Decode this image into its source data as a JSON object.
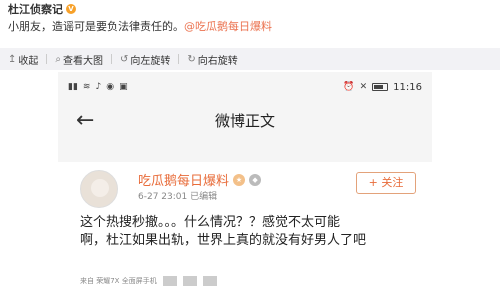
{
  "post": {
    "author": "杜江侦察记",
    "verified_icon": "v-badge-icon",
    "text_prefix": "小朋友，造谣可是要负法律责任的。",
    "mention": "@吃瓜鹅每日爆料"
  },
  "image_toolbar": {
    "items": [
      {
        "icon": "collapse-icon",
        "glyph": "↥",
        "label": "收起"
      },
      {
        "icon": "zoom-icon",
        "glyph": "⌕",
        "label": "查看大图"
      },
      {
        "icon": "rotate-left-icon",
        "glyph": "↺",
        "label": "向左旋转"
      },
      {
        "icon": "rotate-right-icon",
        "glyph": "↻",
        "label": "向右旋转"
      }
    ]
  },
  "screenshot": {
    "status_time": "11:16",
    "nav_title": "微博正文",
    "card": {
      "nickname": "吃瓜鹅每日爆料",
      "meta": "6-27 23:01   已编辑",
      "follow_label": "+ 关注",
      "line1": "这个热搜秒撤。。。什么情况？？感觉不太可能",
      "line2": "啊，杜江如果出轨，世界上真的就没有好男人了吧",
      "footer": "来自 荣耀7X 全面屏手机"
    }
  },
  "colors": {
    "mention": "#eb7350",
    "nickname": "#e86c3a",
    "toolbar_bg": "#f2f2f5"
  }
}
